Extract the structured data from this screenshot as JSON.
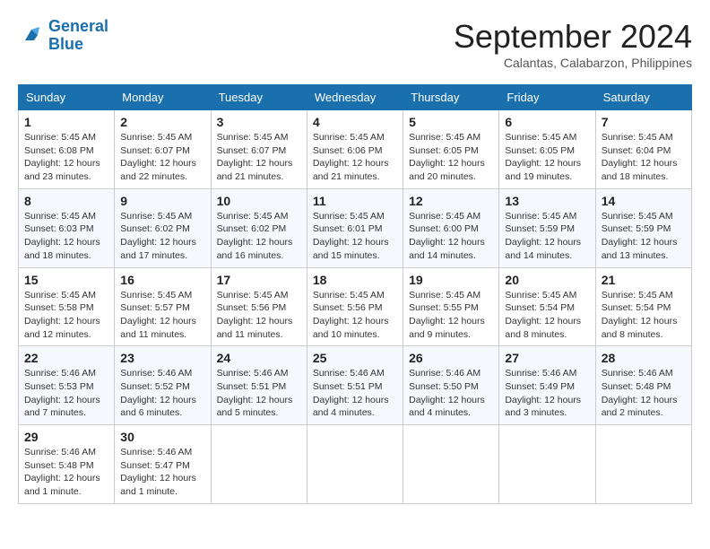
{
  "logo": {
    "line1": "General",
    "line2": "Blue"
  },
  "title": "September 2024",
  "location": "Calantas, Calabarzon, Philippines",
  "days_of_week": [
    "Sunday",
    "Monday",
    "Tuesday",
    "Wednesday",
    "Thursday",
    "Friday",
    "Saturday"
  ],
  "weeks": [
    [
      {
        "day": "1",
        "sunrise": "5:45 AM",
        "sunset": "6:08 PM",
        "daylight": "12 hours and 23 minutes."
      },
      {
        "day": "2",
        "sunrise": "5:45 AM",
        "sunset": "6:07 PM",
        "daylight": "12 hours and 22 minutes."
      },
      {
        "day": "3",
        "sunrise": "5:45 AM",
        "sunset": "6:07 PM",
        "daylight": "12 hours and 21 minutes."
      },
      {
        "day": "4",
        "sunrise": "5:45 AM",
        "sunset": "6:06 PM",
        "daylight": "12 hours and 21 minutes."
      },
      {
        "day": "5",
        "sunrise": "5:45 AM",
        "sunset": "6:05 PM",
        "daylight": "12 hours and 20 minutes."
      },
      {
        "day": "6",
        "sunrise": "5:45 AM",
        "sunset": "6:05 PM",
        "daylight": "12 hours and 19 minutes."
      },
      {
        "day": "7",
        "sunrise": "5:45 AM",
        "sunset": "6:04 PM",
        "daylight": "12 hours and 18 minutes."
      }
    ],
    [
      {
        "day": "8",
        "sunrise": "5:45 AM",
        "sunset": "6:03 PM",
        "daylight": "12 hours and 18 minutes."
      },
      {
        "day": "9",
        "sunrise": "5:45 AM",
        "sunset": "6:02 PM",
        "daylight": "12 hours and 17 minutes."
      },
      {
        "day": "10",
        "sunrise": "5:45 AM",
        "sunset": "6:02 PM",
        "daylight": "12 hours and 16 minutes."
      },
      {
        "day": "11",
        "sunrise": "5:45 AM",
        "sunset": "6:01 PM",
        "daylight": "12 hours and 15 minutes."
      },
      {
        "day": "12",
        "sunrise": "5:45 AM",
        "sunset": "6:00 PM",
        "daylight": "12 hours and 14 minutes."
      },
      {
        "day": "13",
        "sunrise": "5:45 AM",
        "sunset": "5:59 PM",
        "daylight": "12 hours and 14 minutes."
      },
      {
        "day": "14",
        "sunrise": "5:45 AM",
        "sunset": "5:59 PM",
        "daylight": "12 hours and 13 minutes."
      }
    ],
    [
      {
        "day": "15",
        "sunrise": "5:45 AM",
        "sunset": "5:58 PM",
        "daylight": "12 hours and 12 minutes."
      },
      {
        "day": "16",
        "sunrise": "5:45 AM",
        "sunset": "5:57 PM",
        "daylight": "12 hours and 11 minutes."
      },
      {
        "day": "17",
        "sunrise": "5:45 AM",
        "sunset": "5:56 PM",
        "daylight": "12 hours and 11 minutes."
      },
      {
        "day": "18",
        "sunrise": "5:45 AM",
        "sunset": "5:56 PM",
        "daylight": "12 hours and 10 minutes."
      },
      {
        "day": "19",
        "sunrise": "5:45 AM",
        "sunset": "5:55 PM",
        "daylight": "12 hours and 9 minutes."
      },
      {
        "day": "20",
        "sunrise": "5:45 AM",
        "sunset": "5:54 PM",
        "daylight": "12 hours and 8 minutes."
      },
      {
        "day": "21",
        "sunrise": "5:45 AM",
        "sunset": "5:54 PM",
        "daylight": "12 hours and 8 minutes."
      }
    ],
    [
      {
        "day": "22",
        "sunrise": "5:46 AM",
        "sunset": "5:53 PM",
        "daylight": "12 hours and 7 minutes."
      },
      {
        "day": "23",
        "sunrise": "5:46 AM",
        "sunset": "5:52 PM",
        "daylight": "12 hours and 6 minutes."
      },
      {
        "day": "24",
        "sunrise": "5:46 AM",
        "sunset": "5:51 PM",
        "daylight": "12 hours and 5 minutes."
      },
      {
        "day": "25",
        "sunrise": "5:46 AM",
        "sunset": "5:51 PM",
        "daylight": "12 hours and 4 minutes."
      },
      {
        "day": "26",
        "sunrise": "5:46 AM",
        "sunset": "5:50 PM",
        "daylight": "12 hours and 4 minutes."
      },
      {
        "day": "27",
        "sunrise": "5:46 AM",
        "sunset": "5:49 PM",
        "daylight": "12 hours and 3 minutes."
      },
      {
        "day": "28",
        "sunrise": "5:46 AM",
        "sunset": "5:48 PM",
        "daylight": "12 hours and 2 minutes."
      }
    ],
    [
      {
        "day": "29",
        "sunrise": "5:46 AM",
        "sunset": "5:48 PM",
        "daylight": "12 hours and 1 minute."
      },
      {
        "day": "30",
        "sunrise": "5:46 AM",
        "sunset": "5:47 PM",
        "daylight": "12 hours and 1 minute."
      },
      null,
      null,
      null,
      null,
      null
    ]
  ]
}
